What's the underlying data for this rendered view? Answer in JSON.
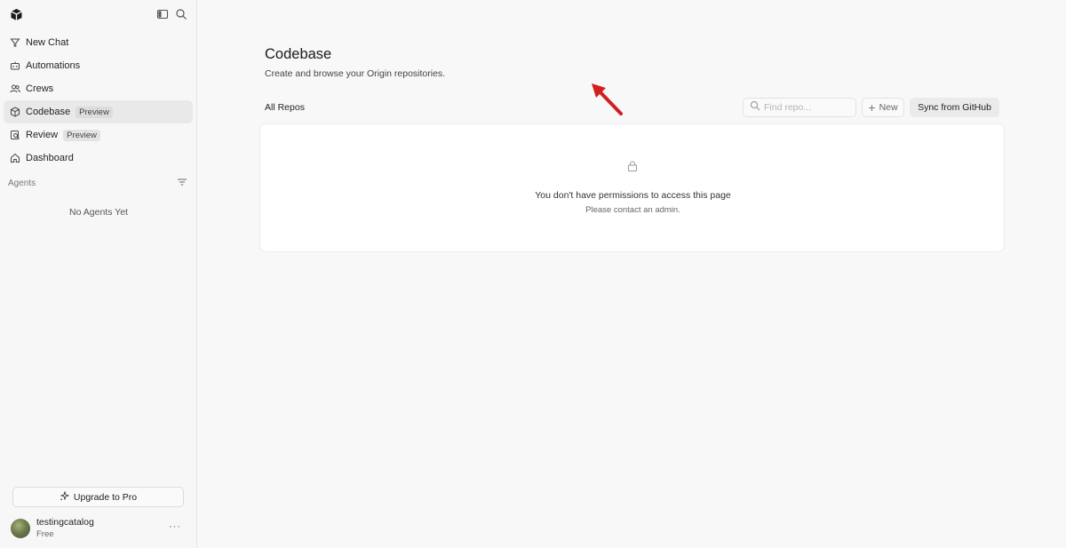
{
  "sidebar": {
    "items": [
      {
        "label": "New Chat",
        "icon": "funnel-icon"
      },
      {
        "label": "Automations",
        "icon": "robot-icon"
      },
      {
        "label": "Crews",
        "icon": "users-icon"
      },
      {
        "label": "Codebase",
        "icon": "cube-icon",
        "badge": "Preview",
        "active": true
      },
      {
        "label": "Review",
        "icon": "review-icon",
        "badge": "Preview"
      },
      {
        "label": "Dashboard",
        "icon": "home-icon"
      }
    ],
    "agents_label": "Agents",
    "no_agents": "No Agents Yet",
    "upgrade_label": "Upgrade to Pro",
    "user": {
      "name": "testingcatalog",
      "plan": "Free",
      "more": "···"
    }
  },
  "main": {
    "title": "Codebase",
    "subtitle": "Create and browse your Origin repositories.",
    "tab_all": "All Repos",
    "search": {
      "placeholder": "Find repo...",
      "value": ""
    },
    "new_label": "New",
    "sync_label": "Sync from GitHub",
    "empty": {
      "title": "You don't have permissions to access this page",
      "subtitle": "Please contact an admin."
    }
  },
  "colors": {
    "arrow": "#d21f1f",
    "active_bg": "#e9e9e9",
    "background": "#f8f8f8"
  }
}
